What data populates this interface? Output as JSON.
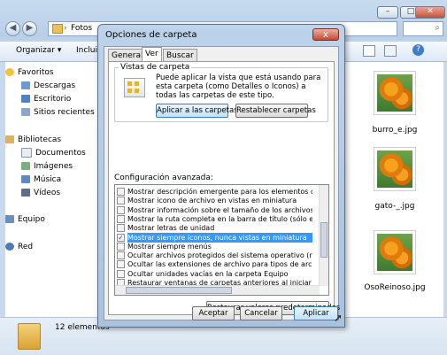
{
  "explorer": {
    "address": "Fotos",
    "toolbar": {
      "organize": "Organizar",
      "include": "Incluir"
    },
    "sidebar": {
      "favorites": "Favoritos",
      "downloads": "Descargas",
      "desktop": "Escritorio",
      "recent": "Sitios recientes",
      "libraries": "Bibliotecas",
      "documents": "Documentos",
      "images": "Imágenes",
      "music": "Música",
      "videos": "Vídeos",
      "computer": "Equipo",
      "network": "Red"
    },
    "files": [
      "burro_e.jpg",
      "gato-_.jpg",
      "OsoReinoso.jpg"
    ],
    "status": "12 elementos",
    "search_icon": "search-icon"
  },
  "dialog": {
    "title": "Opciones de carpeta",
    "tabs": [
      "General",
      "Ver",
      "Buscar"
    ],
    "active_tab": "Ver",
    "folder_views": {
      "label": "Vistas de carpeta",
      "text": "Puede aplicar la vista que está usando para esta carpeta (como Detalles o Iconos) a todas las carpetas de este tipo.",
      "apply_button": "Aplicar a las carpetas",
      "reset_button": "Restablecer carpetas"
    },
    "advanced_label": "Configuración avanzada:",
    "options": [
      {
        "label": "Mostrar descripción emergente para los elementos de car",
        "checked": false
      },
      {
        "label": "Mostrar icono de archivo en vistas en miniatura",
        "checked": false
      },
      {
        "label": "Mostrar información sobre el tamaño de los archivos en su",
        "checked": false
      },
      {
        "label": "Mostrar la ruta completa en la barra de título (sólo el tema",
        "checked": false
      },
      {
        "label": "Mostrar letras de unidad",
        "checked": false
      },
      {
        "label": "Mostrar siempre iconos, nunca vistas en miniatura",
        "checked": true,
        "selected": true
      },
      {
        "label": "Mostrar siempre menús",
        "checked": false
      },
      {
        "label": "Ocultar archivos protegidos del sistema operativo (recome",
        "checked": false
      },
      {
        "label": "Ocultar las extensiones de archivo para tipos de archivo c",
        "checked": false
      },
      {
        "label": "Ocultar unidades vacías en la carpeta Equipo",
        "checked": false
      },
      {
        "label": "Restaurar ventanas de carpetas anteriores al iniciar sesió",
        "checked": false
      }
    ],
    "restore_defaults": "Restaurar valores predeterminados",
    "buttons": {
      "accept": "Aceptar",
      "cancel": "Cancelar",
      "apply": "Aplicar"
    },
    "close_glyph": "x"
  }
}
